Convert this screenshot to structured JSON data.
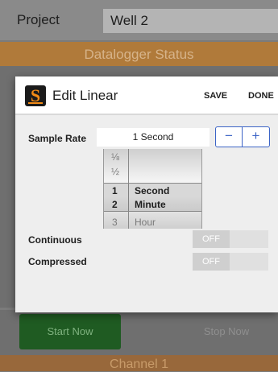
{
  "background": {
    "project_label": "Project",
    "project_value": "Well 2",
    "section_title": "Datalogger Status",
    "start_button": "Start Now",
    "stop_button": "Stop Now",
    "channel_title": "Channel 1"
  },
  "dialog": {
    "title": "Edit Linear",
    "save_label": "SAVE",
    "done_label": "DONE",
    "sample_rate_label": "Sample Rate",
    "sample_rate_value": "1 Second",
    "stepper_minus": "−",
    "stepper_plus": "+",
    "picker": {
      "left_items": [
        "⅛",
        "½",
        "1",
        "2",
        "3"
      ],
      "right_items": [
        "Second",
        "Minute",
        "Hour"
      ],
      "selected": {
        "value": "1",
        "unit": "Second"
      }
    },
    "continuous_label": "Continuous",
    "continuous_state": "OFF",
    "compressed_label": "Compressed",
    "compressed_state": "OFF"
  },
  "colors": {
    "accent_orange": "#b07a3a",
    "stepper_blue": "#3c64c6",
    "start_green": "#1f5b22",
    "logo_orange": "#f28b16"
  },
  "icons": {
    "app_logo": "s-logo-icon"
  }
}
